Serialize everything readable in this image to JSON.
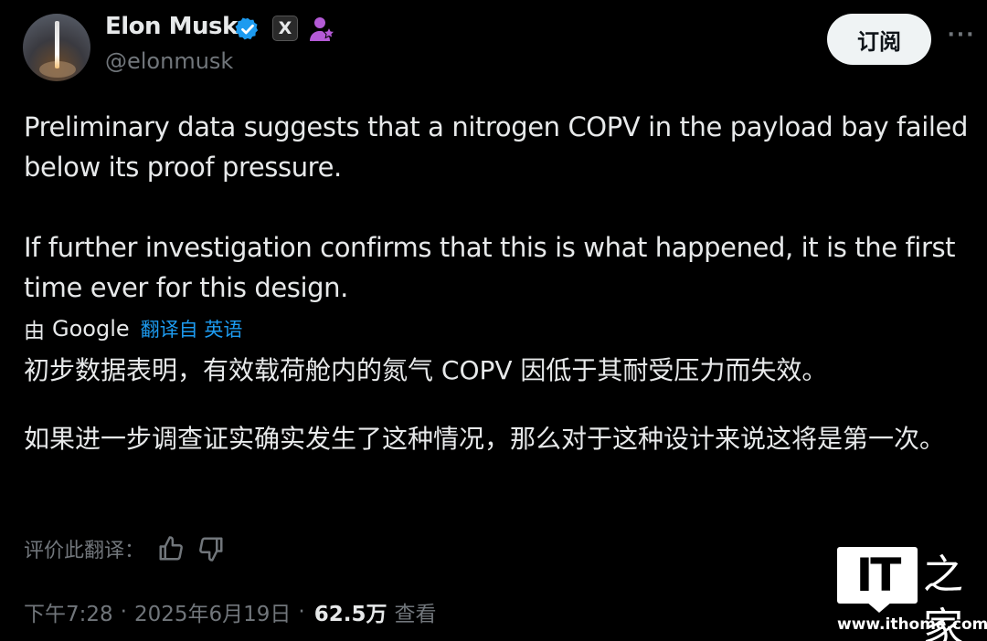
{
  "header": {
    "name": "Elon Musk",
    "handle": "@elonmusk",
    "x_badge": "X",
    "subscribe_label": "订阅",
    "more_label": "···",
    "verified_color": "#1d9bf0"
  },
  "tweet": {
    "paragraph1": "Preliminary data suggests that a nitrogen COPV in the payload bay failed below its proof pressure.",
    "paragraph2": "If further investigation confirms that this is what happened, it is the first time ever for this design."
  },
  "translation": {
    "by": "由",
    "provider": "Google",
    "translated_from": "翻译自 英语",
    "paragraph1": "初步数据表明，有效载荷舱内的氮气 COPV 因低于其耐受压力而失效。",
    "paragraph2": "如果进一步调查证实确实发生了这种情况，那么对于这种设计来说这将是第一次。",
    "rate_label": "评价此翻译："
  },
  "meta": {
    "time": "下午7:28",
    "separator": "·",
    "date": "2025年6月19日",
    "views": "62.5万",
    "views_label": "查看"
  },
  "watermark": {
    "logo_text": "IT",
    "cn_text": "之家",
    "url": "www.ithome.com"
  }
}
